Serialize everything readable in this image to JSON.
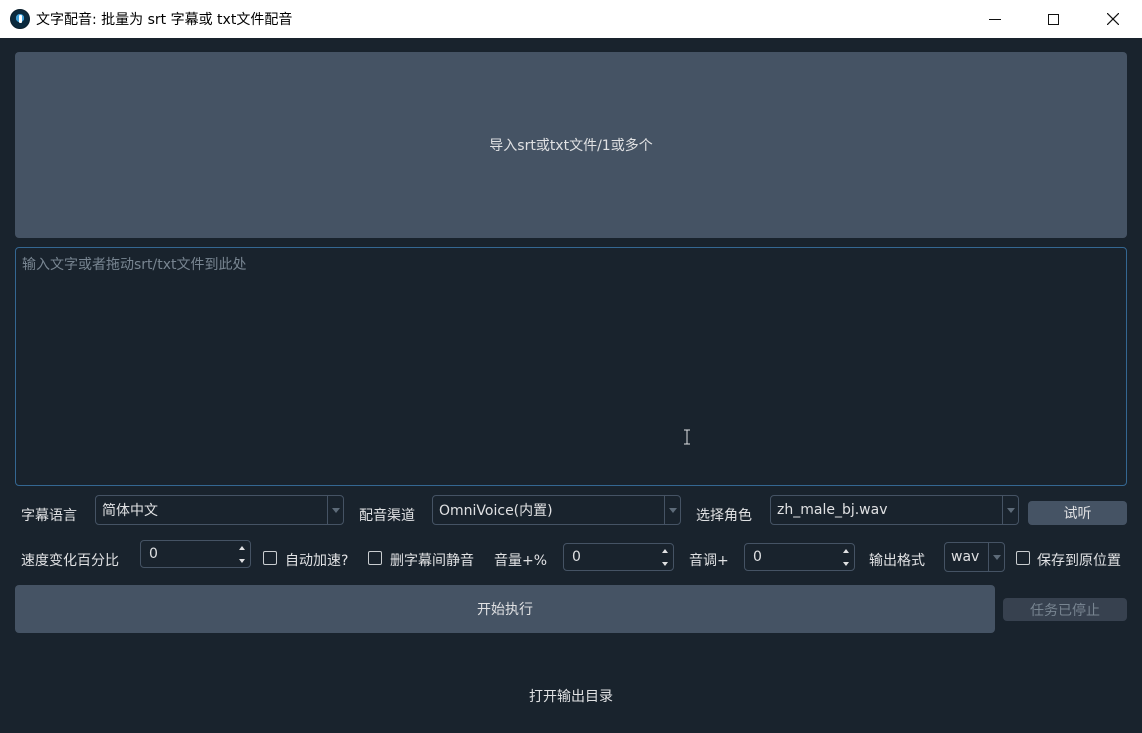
{
  "window": {
    "title": "文字配音: 批量为 srt 字幕或 txt文件配音"
  },
  "import_button": "导入srt或txt文件/1或多个",
  "text_input": {
    "placeholder": "输入文字或者拖动srt/txt文件到此处",
    "value": ""
  },
  "row1": {
    "subtitle_language_label": "字幕语言",
    "subtitle_language_value": "简体中文",
    "dubbing_channel_label": "配音渠道",
    "dubbing_channel_value": "OmniVoice(内置)",
    "role_label": "选择角色",
    "role_value": "zh_male_bj.wav",
    "listen_button": "试听"
  },
  "row2": {
    "speed_label": "速度变化百分比",
    "speed_value": "0",
    "auto_speed_label": "自动加速?",
    "remove_silence_label": "删字幕间静音",
    "volume_label": "音量+%",
    "volume_value": "0",
    "pitch_label": "音调+",
    "pitch_value": "0",
    "format_label": "输出格式",
    "format_value": "wav",
    "save_original_label": "保存到原位置"
  },
  "actions": {
    "start_button": "开始执行",
    "stopped_button": "任务已停止",
    "open_output_dir": "打开输出目录"
  },
  "colors": {
    "background": "#19232d",
    "panel": "#455364",
    "accent_border": "#346792",
    "placeholder": "#788591"
  }
}
